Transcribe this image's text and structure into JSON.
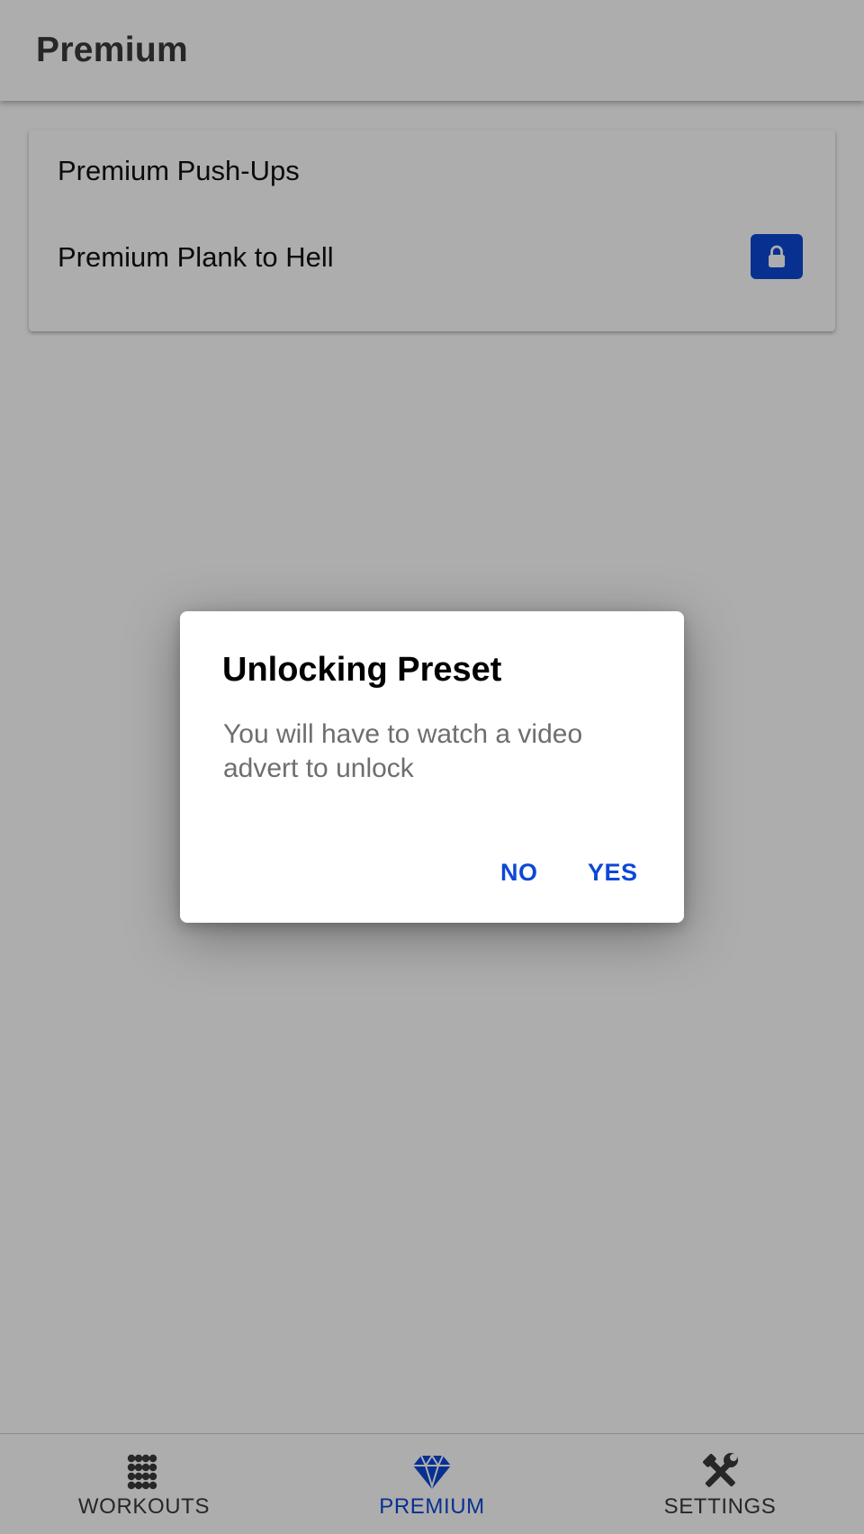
{
  "header": {
    "title": "Premium"
  },
  "presets": [
    {
      "name": "Premium Push-Ups",
      "locked": false
    },
    {
      "name": "Premium Plank to Hell",
      "locked": true
    }
  ],
  "dialog": {
    "title": "Unlocking Preset",
    "message": "You will have to watch a video advert to unlock",
    "no_label": "NO",
    "yes_label": "YES"
  },
  "bottom_nav": {
    "items": [
      {
        "label": "WORKOUTS",
        "icon": "grid-dots-icon",
        "active": false
      },
      {
        "label": "PREMIUM",
        "icon": "diamond-icon",
        "active": true
      },
      {
        "label": "SETTINGS",
        "icon": "tools-icon",
        "active": false
      }
    ]
  },
  "colors": {
    "accent": "#0d48d6",
    "text_dark": "#3a3a3a",
    "text_muted": "#6e6e6e",
    "scrim": "rgba(0,0,0,0.32)"
  }
}
